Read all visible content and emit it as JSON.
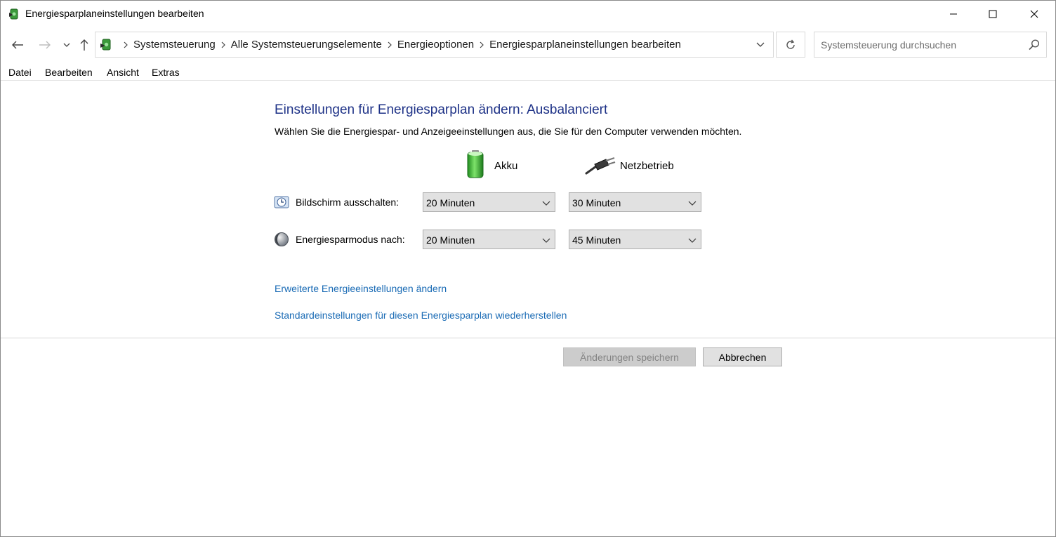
{
  "window": {
    "title": "Energiesparplaneinstellungen bearbeiten"
  },
  "navigation": {
    "breadcrumbs": [
      "Systemsteuerung",
      "Alle Systemsteuerungselemente",
      "Energieoptionen",
      "Energiesparplaneinstellungen bearbeiten"
    ],
    "search_placeholder": "Systemsteuerung durchsuchen"
  },
  "menu": [
    "Datei",
    "Bearbeiten",
    "Ansicht",
    "Extras"
  ],
  "main": {
    "heading": "Einstellungen für Energiesparplan ändern: Ausbalanciert",
    "subtext": "Wählen Sie die Energiespar- und Anzeigeeinstellungen aus, die Sie für den Computer verwenden möchten.",
    "columns": {
      "battery": "Akku",
      "plugged_in": "Netzbetrieb"
    },
    "settings": [
      {
        "label": "Bildschirm ausschalten:",
        "icon": "display-clock-icon",
        "battery_value": "20 Minuten",
        "plugged_value": "30 Minuten"
      },
      {
        "label": "Energiesparmodus nach:",
        "icon": "moon-sleep-icon",
        "battery_value": "20 Minuten",
        "plugged_value": "45 Minuten"
      }
    ],
    "links": {
      "advanced": "Erweiterte Energieeinstellungen ändern",
      "restore": "Standardeinstellungen für diesen Energiesparplan wiederherstellen"
    }
  },
  "buttons": {
    "save": "Änderungen speichern",
    "cancel": "Abbrechen"
  },
  "colors": {
    "heading": "#1e3287",
    "link": "#1a6bb5",
    "button_bg": "#e1e1e1",
    "disabled_text": "#838383"
  }
}
